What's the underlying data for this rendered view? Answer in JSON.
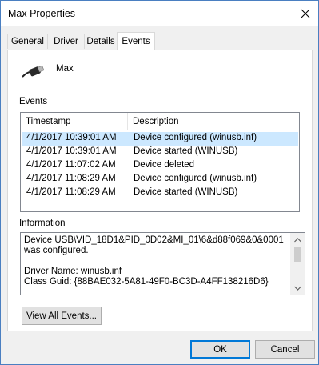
{
  "window": {
    "title": "Max Properties",
    "close_icon": "close-icon"
  },
  "tabs": [
    {
      "label": "General"
    },
    {
      "label": "Driver"
    },
    {
      "label": "Details"
    },
    {
      "label": "Events",
      "active": true
    }
  ],
  "device": {
    "icon": "usb-cable-icon",
    "name": "Max"
  },
  "events": {
    "label": "Events",
    "columns": [
      "Timestamp",
      "Description"
    ],
    "rows": [
      {
        "timestamp": "4/1/2017 10:39:01 AM",
        "description": "Device configured (winusb.inf)",
        "selected": true
      },
      {
        "timestamp": "4/1/2017 10:39:01 AM",
        "description": "Device started (WINUSB)"
      },
      {
        "timestamp": "4/1/2017 11:07:02 AM",
        "description": "Device deleted"
      },
      {
        "timestamp": "4/1/2017 11:08:29 AM",
        "description": "Device configured (winusb.inf)"
      },
      {
        "timestamp": "4/1/2017 11:08:29 AM",
        "description": "Device started (WINUSB)"
      }
    ]
  },
  "information": {
    "label": "Information",
    "text": "Device USB\\VID_18D1&PID_0D02&MI_01\\6&d88f069&0&0001 was configured.\n\nDriver Name: winusb.inf\nClass Guid: {88BAE032-5A81-49F0-BC3D-A4FF138216D6}"
  },
  "buttons": {
    "view_all": "View All Events...",
    "ok": "OK",
    "cancel": "Cancel"
  },
  "colors": {
    "selection": "#cce8ff",
    "accent": "#0078d7",
    "window_border": "#4a7fc1"
  }
}
